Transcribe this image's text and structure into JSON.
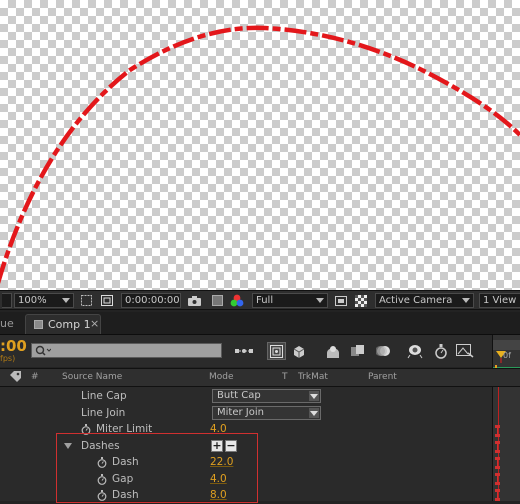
{
  "viewer_toolbar": {
    "zoom": "100%",
    "timecode": "0:00:00:00",
    "resolution": "Full",
    "camera": "Active Camera",
    "view": "1 View"
  },
  "tabs": {
    "previous_tab_fragment": "ue",
    "active_tab_label": "Comp 1",
    "close_glyph": "×"
  },
  "timeline_controls": {
    "current_time": ":00",
    "fps": "fps)",
    "search_placeholder": "",
    "ruler_label": "0f"
  },
  "columns": {
    "hash": "#",
    "source_name": "Source Name",
    "mode": "Mode",
    "t": "T",
    "trkmat": "TrkMat",
    "parent": "Parent"
  },
  "layer_properties": [
    {
      "label": "Line Cap",
      "dropdown": "Butt Cap"
    },
    {
      "label": "Line Join",
      "dropdown": "Miter Join"
    },
    {
      "label": "Miter Limit",
      "value": "4.0"
    },
    {
      "label": "Dashes"
    },
    {
      "label": "Dash",
      "value": "22.0"
    },
    {
      "label": "Gap",
      "value": "4.0"
    },
    {
      "label": "Dash",
      "value": "8.0"
    }
  ],
  "colors": {
    "stroke": "#e3171b",
    "value_orange": "#e0a020",
    "highlight_box": "#d03030",
    "panel_bg": "#2a2a2a"
  },
  "icons": [
    "magnifier-icon",
    "stopwatch-icon",
    "camera-icon",
    "color-channels-icon",
    "checkerboard-icon",
    "plus-icon",
    "minus-icon"
  ]
}
